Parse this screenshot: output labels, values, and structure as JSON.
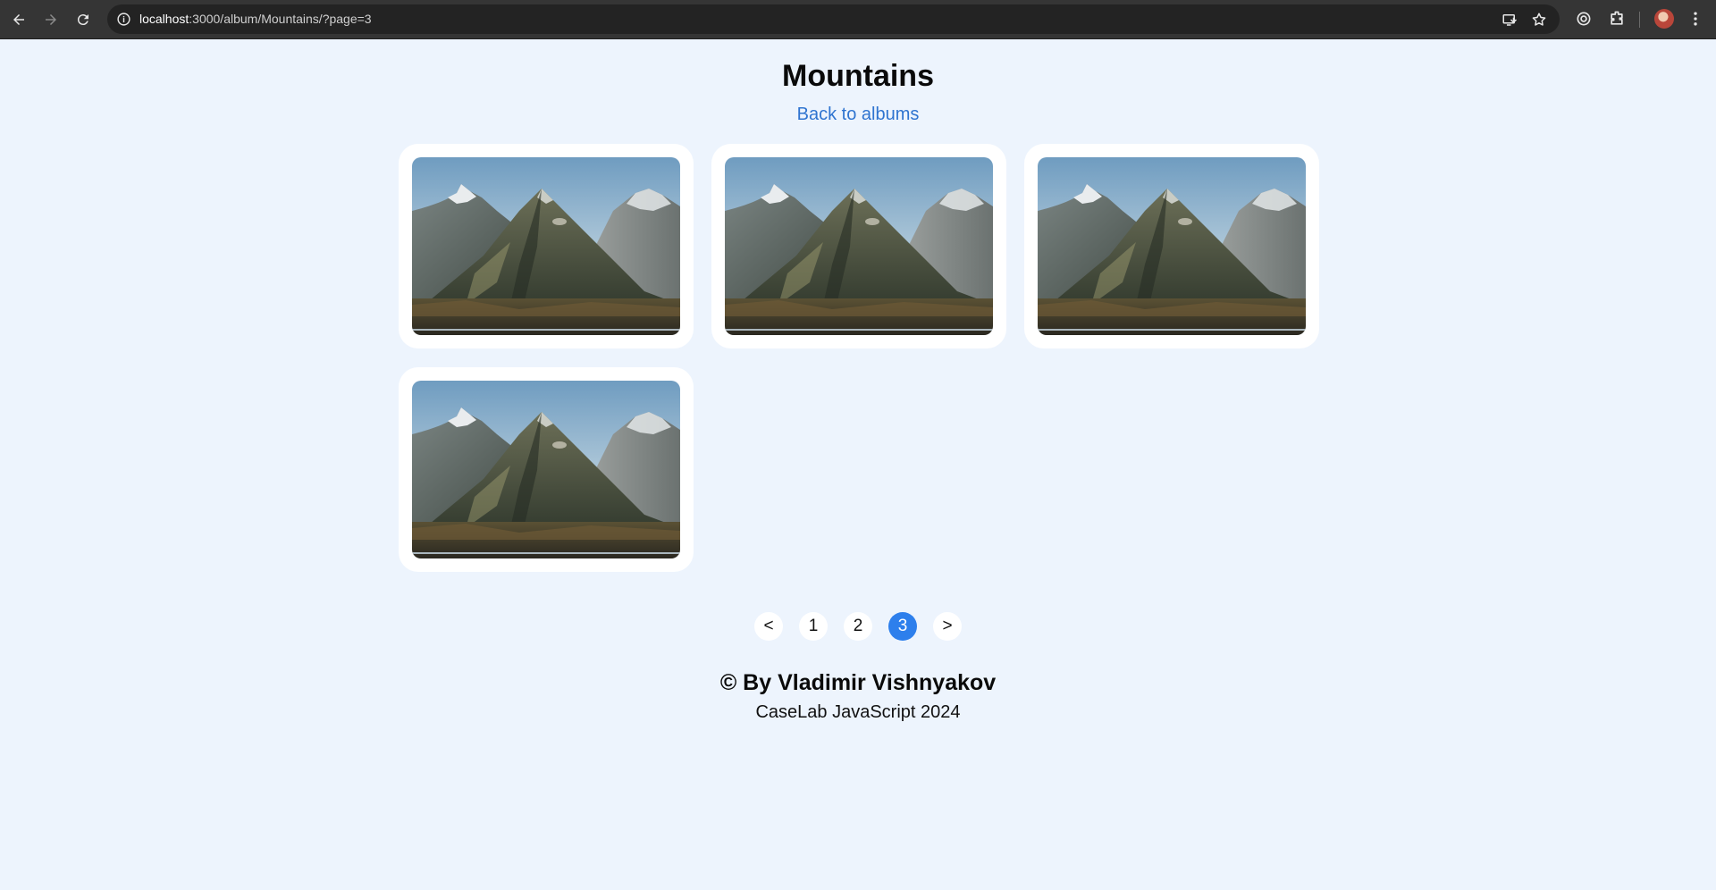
{
  "browser": {
    "url_host": "localhost",
    "url_path": ":3000/album/Mountains/?page=3"
  },
  "page": {
    "title": "Mountains",
    "back_link": "Back to albums"
  },
  "photos": [
    {
      "alt": "mountain-photo"
    },
    {
      "alt": "mountain-photo"
    },
    {
      "alt": "mountain-photo"
    },
    {
      "alt": "mountain-photo"
    }
  ],
  "pagination": {
    "prev": "<",
    "pages": [
      "1",
      "2",
      "3"
    ],
    "current": "3",
    "next": ">"
  },
  "footer": {
    "author": "© By Vladimir Vishnyakov",
    "subtitle": "CaseLab JavaScript 2024"
  },
  "colors": {
    "background": "#edf4fd",
    "link": "#2f74d0",
    "active_page": "#2d7fec"
  }
}
